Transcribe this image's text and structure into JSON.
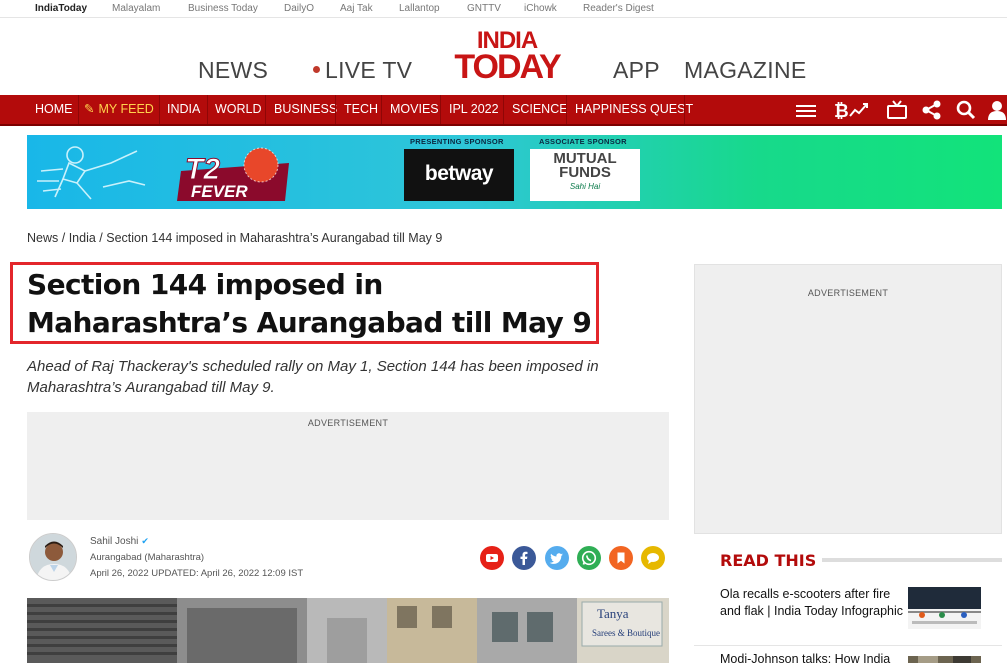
{
  "topbar": {
    "sites": [
      "IndiaToday",
      "Malayalam",
      "Business Today",
      "DailyO",
      "Aaj Tak",
      "Lallantop",
      "GNTTV",
      "iChowk",
      "Reader's Digest"
    ]
  },
  "header": {
    "nav_news": "NEWS",
    "nav_live": "LIVE TV",
    "logo_line1": "INDIA",
    "logo_line2": "TODAY",
    "nav_app": "APP",
    "nav_magazine": "MAGAZINE"
  },
  "rednav": {
    "items": [
      "HOME",
      "MY FEED",
      "INDIA",
      "WORLD",
      "BUSINESS",
      "TECH",
      "MOVIES",
      "IPL 2022",
      "SCIENCE",
      "HAPPINESS QUEST"
    ],
    "icons": [
      "menu-icon",
      "crypto-icon",
      "tv-icon",
      "share-icon",
      "search-icon",
      "user-icon"
    ]
  },
  "banner": {
    "t20_top": "T20",
    "t20_bottom": "FEVER",
    "presenting_label": "PRESENTING SPONSOR",
    "presenting_brand": "betway",
    "associate_label": "ASSOCIATE SPONSOR",
    "associate_line1": "MUTUAL",
    "associate_line2": "FUNDS",
    "associate_tag": "Sahi Hai"
  },
  "breadcrumb": {
    "home": "News",
    "section": "India",
    "current": "Section 144 imposed in Maharashtra’s Aurangabad till May 9"
  },
  "article": {
    "headline": "Section 144 imposed in Maharashtra’s Aurangabad till May 9",
    "dek": "Ahead of Raj Thackeray's scheduled rally on May 1, Section 144 has been imposed in Maharashtra’s Aurangabad till May 9.",
    "ad_label": "ADVERTISEMENT",
    "author": "Sahil Joshi",
    "location": "Aurangabad (Maharashtra)",
    "dateline": "April 26, 2022  UPDATED: April 26, 2022 12:09 IST",
    "share_icons": [
      "youtube-icon",
      "facebook-icon",
      "twitter-icon",
      "whatsapp-icon",
      "bookmark-icon",
      "comment-icon"
    ],
    "colors": {
      "youtube": "#e62117",
      "facebook": "#3b5998",
      "twitter": "#55acee",
      "whatsapp": "#2fae55",
      "bookmark": "#f26522",
      "comment": "#e6b800"
    }
  },
  "sidebar": {
    "ad_label": "ADVERTISEMENT",
    "read_this_title": "READ THIS",
    "items": [
      "Ola recalls e-scooters after fire and flak | India Today Infographic",
      "Modi-Johnson talks: How India"
    ]
  },
  "colors": {
    "brand_red": "#b30b0b",
    "logo_red": "#c81515",
    "highlight_box": "#e3262b"
  }
}
